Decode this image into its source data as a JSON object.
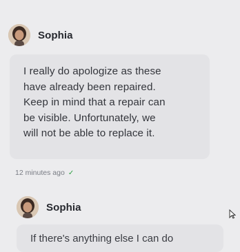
{
  "messages": [
    {
      "sender": "Sophia",
      "lines": [
        "I really do apologize as these",
        "have already been repaired.",
        "Keep in mind that a repair can",
        "be visible. Unfortunately, we",
        "will not be able to replace it."
      ],
      "timestamp": "12 minutes ago",
      "status_icon": "check-icon"
    },
    {
      "sender": "Sophia",
      "partial_line": "If there's anything else I can do"
    }
  ],
  "colors": {
    "background": "#ececee",
    "bubble": "#e3e3e6",
    "check": "#2ea043"
  }
}
